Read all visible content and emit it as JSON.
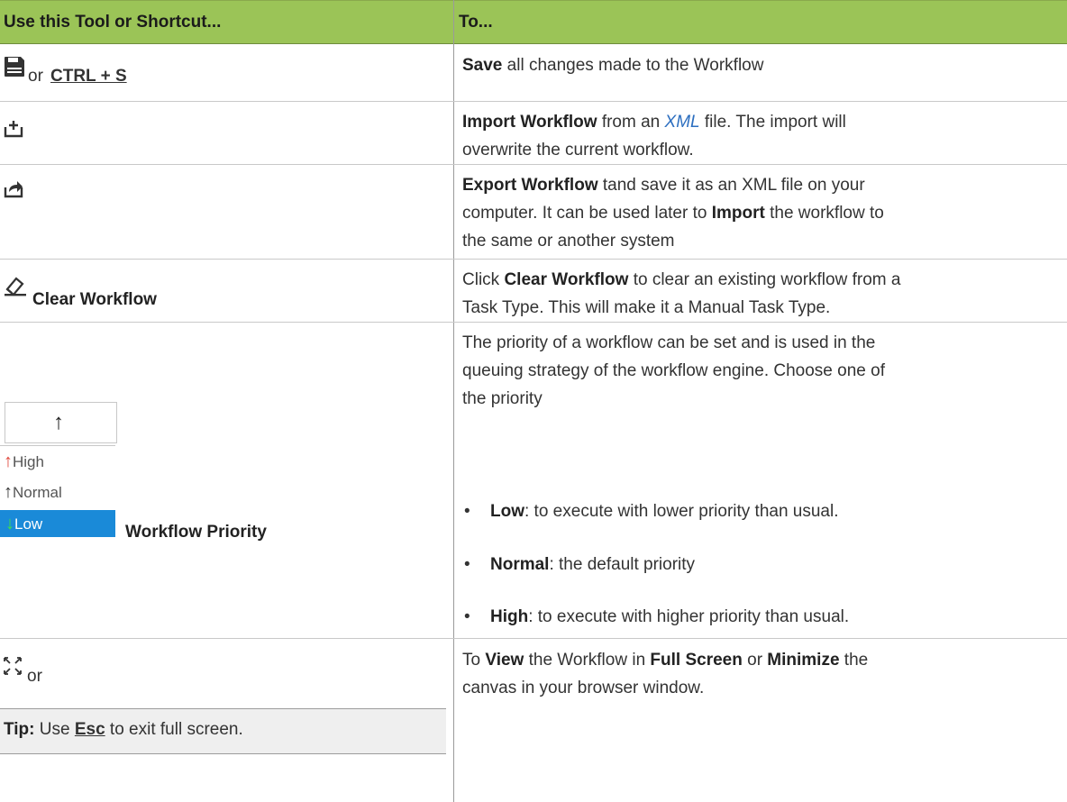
{
  "header": {
    "col1": "Use this Tool or Shortcut...",
    "col2": "To..."
  },
  "rows": {
    "save": {
      "icon": "floppy-disk-icon",
      "or": "or",
      "shortcut": "CTRL + S",
      "desc_bold": "Save",
      "desc_rest": " all changes made to the Workflow"
    },
    "import": {
      "icon": "import-tray-plus-icon",
      "desc_bold": "Import Workflow",
      "desc_mid": " from an ",
      "desc_link": "XML",
      "desc_rest1": " file. The import will",
      "desc_line2": "overwrite the current workflow."
    },
    "export": {
      "icon": "export-share-arrow-icon",
      "desc_bold": "Export Workflow",
      "desc_rest1": "  tand save it as an XML file on your",
      "desc_line2a": "computer. It can be used later to ",
      "desc_line2b": "Import",
      "desc_line2c": "  the workflow to",
      "desc_line3": "the same or another system"
    },
    "clear": {
      "icon": "eraser-icon",
      "label": "Clear Workflow",
      "desc_a": "Click ",
      "desc_bold": "Clear Workflow",
      "desc_b": " to clear an existing workflow from a",
      "desc_line2": "Task Type. This will make it a Manual Task Type."
    },
    "priority": {
      "options": [
        {
          "label": "High",
          "arrow": "↑",
          "arrow_color": "#e0463a"
        },
        {
          "label": "Normal",
          "arrow": "↑",
          "arrow_color": "#333333"
        },
        {
          "label": "Low",
          "arrow": "↓",
          "arrow_color": "#3ec24a"
        }
      ],
      "selected_button_arrow": "↑",
      "label": "Workflow Priority",
      "desc_line1": "The priority of a workflow can be set and is used in the",
      "desc_line2": "queuing strategy of the workflow engine. Choose one of",
      "desc_line3": "the priority",
      "bullets": [
        {
          "bold": "Low",
          "rest": ": to execute with lower priority than usual."
        },
        {
          "bold": "Normal",
          "rest": ": the default priority"
        },
        {
          "bold": "High",
          "rest": ": to execute with higher priority than usual."
        }
      ]
    },
    "fullscreen": {
      "icon": "fullscreen-arrows-icon",
      "or": "or",
      "tip_bold": "Tip:",
      "tip_a": "  Use ",
      "tip_key": "Esc",
      "tip_b": " to exit full screen.",
      "desc_a": "To ",
      "desc_b1": "View",
      "desc_c": " the Workflow in  ",
      "desc_b2": "Full Screen",
      "desc_d": " or ",
      "desc_b3": "Minimize",
      "desc_e": " the",
      "desc_line2": "canvas in your browser window."
    }
  },
  "colors": {
    "header_bg": "#9bc457",
    "selected_low_bg": "#1a8ad8",
    "link": "#2d6fc0"
  }
}
